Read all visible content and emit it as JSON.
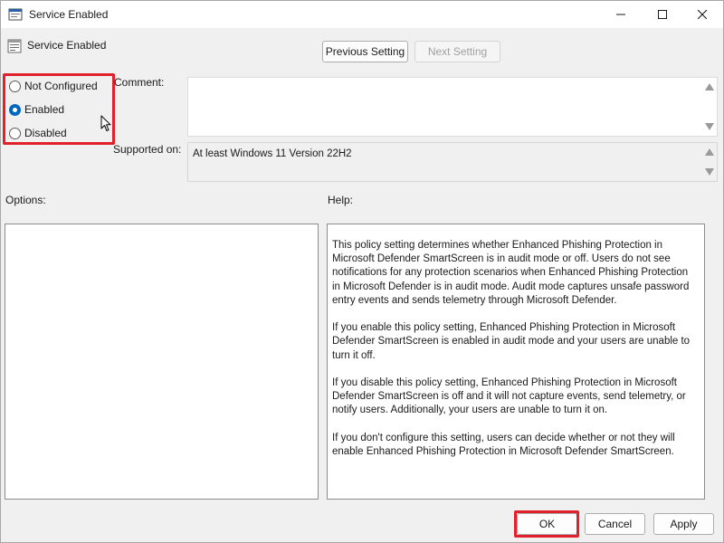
{
  "window": {
    "title": "Service Enabled"
  },
  "header": {
    "policy_name": "Service Enabled",
    "previous_label": "Previous Setting",
    "next_label": "Next Setting"
  },
  "state": {
    "options": [
      {
        "label": "Not Configured",
        "checked": false
      },
      {
        "label": "Enabled",
        "checked": true
      },
      {
        "label": "Disabled",
        "checked": false
      }
    ]
  },
  "comment": {
    "label": "Comment:",
    "value": ""
  },
  "supported": {
    "label": "Supported on:",
    "value": "At least Windows 11 Version 22H2"
  },
  "options_section": {
    "label": "Options:"
  },
  "help": {
    "label": "Help:",
    "paragraphs": [
      "This policy setting determines whether Enhanced Phishing Protection in Microsoft Defender SmartScreen is in audit mode or off. Users do not see notifications for any protection scenarios when Enhanced Phishing Protection in Microsoft Defender is in audit mode. Audit mode captures unsafe password entry events and sends telemetry through Microsoft Defender.",
      "If you enable this policy setting, Enhanced Phishing Protection in Microsoft Defender SmartScreen is enabled in audit mode and your users are unable to turn it off.",
      "If you disable this policy setting, Enhanced Phishing Protection in Microsoft Defender SmartScreen is off and it will not capture events, send telemetry, or notify users. Additionally, your users are unable to turn it on.",
      "If you don't configure this setting, users can decide whether or not they will enable Enhanced Phishing Protection in Microsoft Defender SmartScreen."
    ]
  },
  "footer": {
    "ok_label": "OK",
    "cancel_label": "Cancel",
    "apply_label": "Apply"
  },
  "colors": {
    "accent": "#0067c0",
    "highlight": "#e0202a"
  }
}
